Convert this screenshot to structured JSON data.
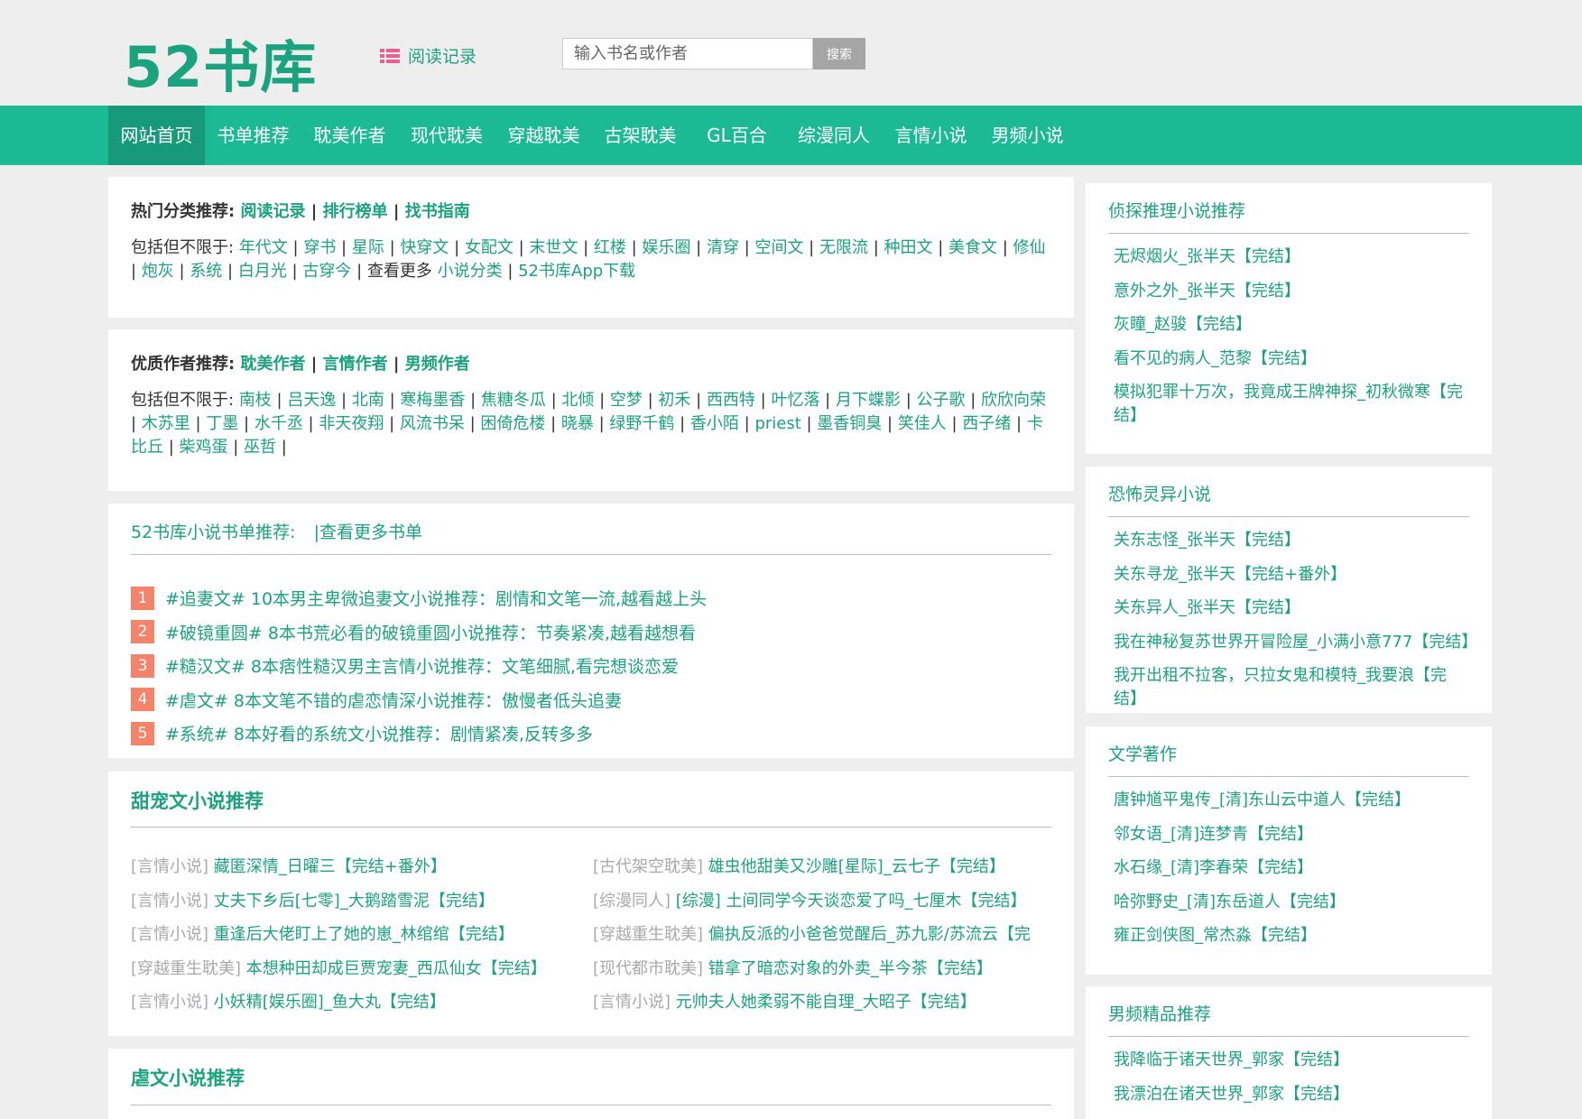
{
  "header": {
    "logo": "52书库",
    "history_label": "阅读记录",
    "search_placeholder": "输入书名或作者",
    "search_button": "搜索"
  },
  "nav": [
    "网站首页",
    "书单推荐",
    "耽美作者",
    "现代耽美",
    "穿越耽美",
    "古架耽美",
    "GL百合",
    "综漫同人",
    "言情小说",
    "男频小说"
  ],
  "hot_categories": {
    "label": "热门分类推荐:",
    "links": [
      "阅读记录",
      "排行榜单",
      "找书指南"
    ],
    "prefix": "包括但不限于:",
    "tags": [
      "年代文",
      "穿书",
      "星际",
      "快穿文",
      "女配文",
      "末世文",
      "红楼",
      "娱乐圈",
      "清穿",
      "空间文",
      "无限流",
      "种田文",
      "美食文",
      "修仙",
      "炮灰",
      "系统",
      "白月光",
      "古穿今"
    ],
    "more_text": "查看更多",
    "more_link": "小说分类",
    "app_link": "52书库App下载"
  },
  "authors": {
    "label": "优质作者推荐:",
    "links": [
      "耽美作者",
      "言情作者",
      "男频作者"
    ],
    "prefix": "包括但不限于:",
    "names": [
      "南枝",
      "吕天逸",
      "北南",
      "寒梅墨香",
      "焦糖冬瓜",
      "北倾",
      "空梦",
      "初禾",
      "西西特",
      "叶忆落",
      "月下蝶影",
      "公子歌",
      "欣欣向荣",
      "木苏里",
      "丁墨",
      "水千丞",
      "非天夜翔",
      "风流书呆",
      "困倚危楼",
      "晓暴",
      "绿野千鹤",
      "香小陌",
      "priest",
      "墨香铜臭",
      "笑佳人",
      "西子绪",
      "卡比丘",
      "柴鸡蛋",
      "巫哲"
    ]
  },
  "booklists": {
    "title": "52书库小说书单推荐:",
    "more": "|查看更多书单",
    "items": [
      {
        "num": "1",
        "text": "#追妻文# 10本男主卑微追妻文小说推荐：剧情和文笔一流,越看越上头"
      },
      {
        "num": "2",
        "text": "#破镜重圆# 8本书荒必看的破镜重圆小说推荐：节奏紧凑,越看越想看"
      },
      {
        "num": "3",
        "text": "#糙汉文# 8本痞性糙汉男主言情小说推荐：文笔细腻,看完想谈恋爱"
      },
      {
        "num": "4",
        "text": "#虐文# 8本文笔不错的虐恋情深小说推荐：傲慢者低头追妻"
      },
      {
        "num": "5",
        "text": "#系统# 8本好看的系统文小说推荐：剧情紧凑,反转多多"
      }
    ]
  },
  "sweet": {
    "title": "甜宠文小说推荐",
    "items": [
      {
        "cat": "[言情小说]",
        "title": "藏匿深情_日曜三【完结+番外】"
      },
      {
        "cat": "[古代架空耽美]",
        "title": "雄虫他甜美又沙雕[星际]_云七子【完结】"
      },
      {
        "cat": "[言情小说]",
        "title": "丈夫下乡后[七零]_大鹅踏雪泥【完结】"
      },
      {
        "cat": "[综漫同人]",
        "title": "[综漫] 土间同学今天谈恋爱了吗_七厘木【完结】"
      },
      {
        "cat": "[言情小说]",
        "title": "重逢后大佬盯上了她的崽_林绾绾【完结】"
      },
      {
        "cat": "[穿越重生耽美]",
        "title": "偏执反派的小爸爸觉醒后_苏九影/苏流云【完"
      },
      {
        "cat": "[穿越重生耽美]",
        "title": "本想种田却成巨贾宠妻_西瓜仙女【完结】"
      },
      {
        "cat": "[现代都市耽美]",
        "title": "错拿了暗恋对象的外卖_半今茶【完结】"
      },
      {
        "cat": "[言情小说]",
        "title": "小妖精[娱乐圈]_鱼大丸【完结】"
      },
      {
        "cat": "[言情小说]",
        "title": "元帅夫人她柔弱不能自理_大昭子【完结】"
      }
    ]
  },
  "abuse": {
    "title": "虐文小说推荐"
  },
  "sidebar": [
    {
      "title": "侦探推理小说推荐",
      "items": [
        "无烬烟火_张半天【完结】",
        "意外之外_张半天【完结】",
        "灰瞳_赵骏【完结】",
        "看不见的病人_范黎【完结】",
        "模拟犯罪十万次，我竟成王牌神探_初秋微寒【完结】"
      ]
    },
    {
      "title": "恐怖灵异小说",
      "items": [
        "关东志怪_张半天【完结】",
        "关东寻龙_张半天【完结+番外】",
        "关东异人_张半天【完结】",
        "我在神秘复苏世界开冒险屋_小满小意777【完结】",
        "我开出租不拉客，只拉女鬼和模特_我要浪【完结】"
      ]
    },
    {
      "title": "文学著作",
      "items": [
        "唐钟馗平鬼传_[清]东山云中道人【完结】",
        "邻女语_[清]连梦青【完结】",
        "水石缘_[清]李春荣【完结】",
        "哈弥野史_[清]东岳道人【完结】",
        "雍正剑侠图_常杰淼【完结】"
      ]
    },
    {
      "title": "男频精品推荐",
      "items": [
        "我降临于诸天世界_郭家【完结】",
        "我漂泊在诸天世界_郭家【完结】"
      ]
    }
  ],
  "colors": {
    "accent": "#1aa37f",
    "nav_bg": "#1cba94",
    "nav_active": "#169a7a",
    "rank_badge": "#f4836a",
    "history_icon": "#e8618c"
  }
}
